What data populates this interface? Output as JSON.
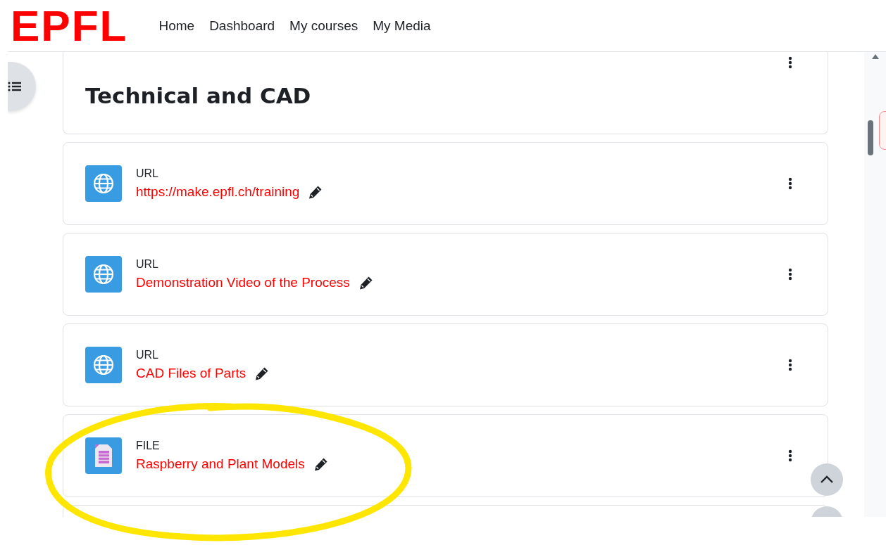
{
  "header": {
    "logo": "EPFL",
    "nav": [
      "Home",
      "Dashboard",
      "My courses",
      "My Media"
    ]
  },
  "section": {
    "title": "Technical and CAD"
  },
  "activities": [
    {
      "kind": "url",
      "type": "URL",
      "name": "https://make.epfl.ch/training"
    },
    {
      "kind": "url",
      "type": "URL",
      "name": "Demonstration Video of the Process"
    },
    {
      "kind": "url",
      "type": "URL",
      "name": "CAD Files of Parts"
    },
    {
      "kind": "file",
      "type": "FILE",
      "name": "Raspberry and Plant Models"
    }
  ]
}
